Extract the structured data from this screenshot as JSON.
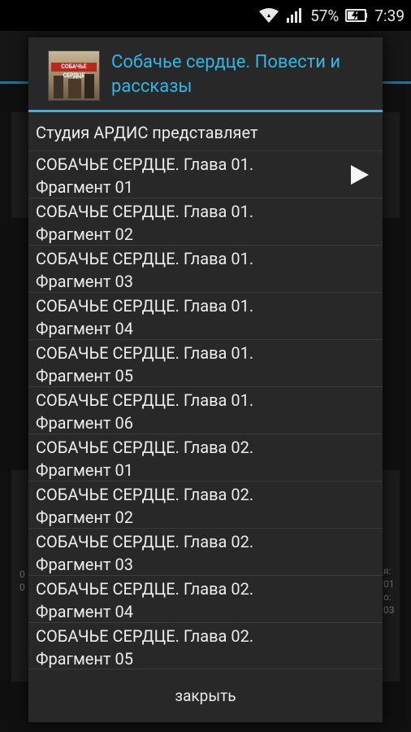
{
  "statusbar": {
    "battery": "57%",
    "time": "7:39"
  },
  "background": {
    "side_text_left": "0\n0",
    "side_text_right": "я:\n01\nо:\n03"
  },
  "dialog": {
    "title": "Собачье сердце. Повести и рассказы",
    "cover_text": "СОБАЧЬЕ СЕРДЦЕ",
    "items": [
      {
        "label": "Студия АРДИС представляет"
      },
      {
        "label": "СОБАЧЬЕ СЕРДЦЕ. Глава 01. Фрагмент 01"
      },
      {
        "label": "СОБАЧЬЕ СЕРДЦЕ. Глава 01. Фрагмент 02"
      },
      {
        "label": "СОБАЧЬЕ СЕРДЦЕ. Глава 01. Фрагмент 03"
      },
      {
        "label": "СОБАЧЬЕ СЕРДЦЕ. Глава 01. Фрагмент 04"
      },
      {
        "label": "СОБАЧЬЕ СЕРДЦЕ. Глава 01. Фрагмент 05"
      },
      {
        "label": "СОБАЧЬЕ СЕРДЦЕ. Глава 01. Фрагмент 06"
      },
      {
        "label": "СОБАЧЬЕ СЕРДЦЕ. Глава 02. Фрагмент 01"
      },
      {
        "label": "СОБАЧЬЕ СЕРДЦЕ. Глава 02. Фрагмент 02"
      },
      {
        "label": "СОБАЧЬЕ СЕРДЦЕ. Глава 02. Фрагмент 03"
      },
      {
        "label": "СОБАЧЬЕ СЕРДЦЕ. Глава 02. Фрагмент 04"
      },
      {
        "label": "СОБАЧЬЕ СЕРДЦЕ. Глава 02. Фрагмент 05"
      }
    ],
    "close_label": "закрыть"
  },
  "colors": {
    "accent": "#33b5e5",
    "dialog_bg": "#282828",
    "divider": "#3a3a3a"
  }
}
